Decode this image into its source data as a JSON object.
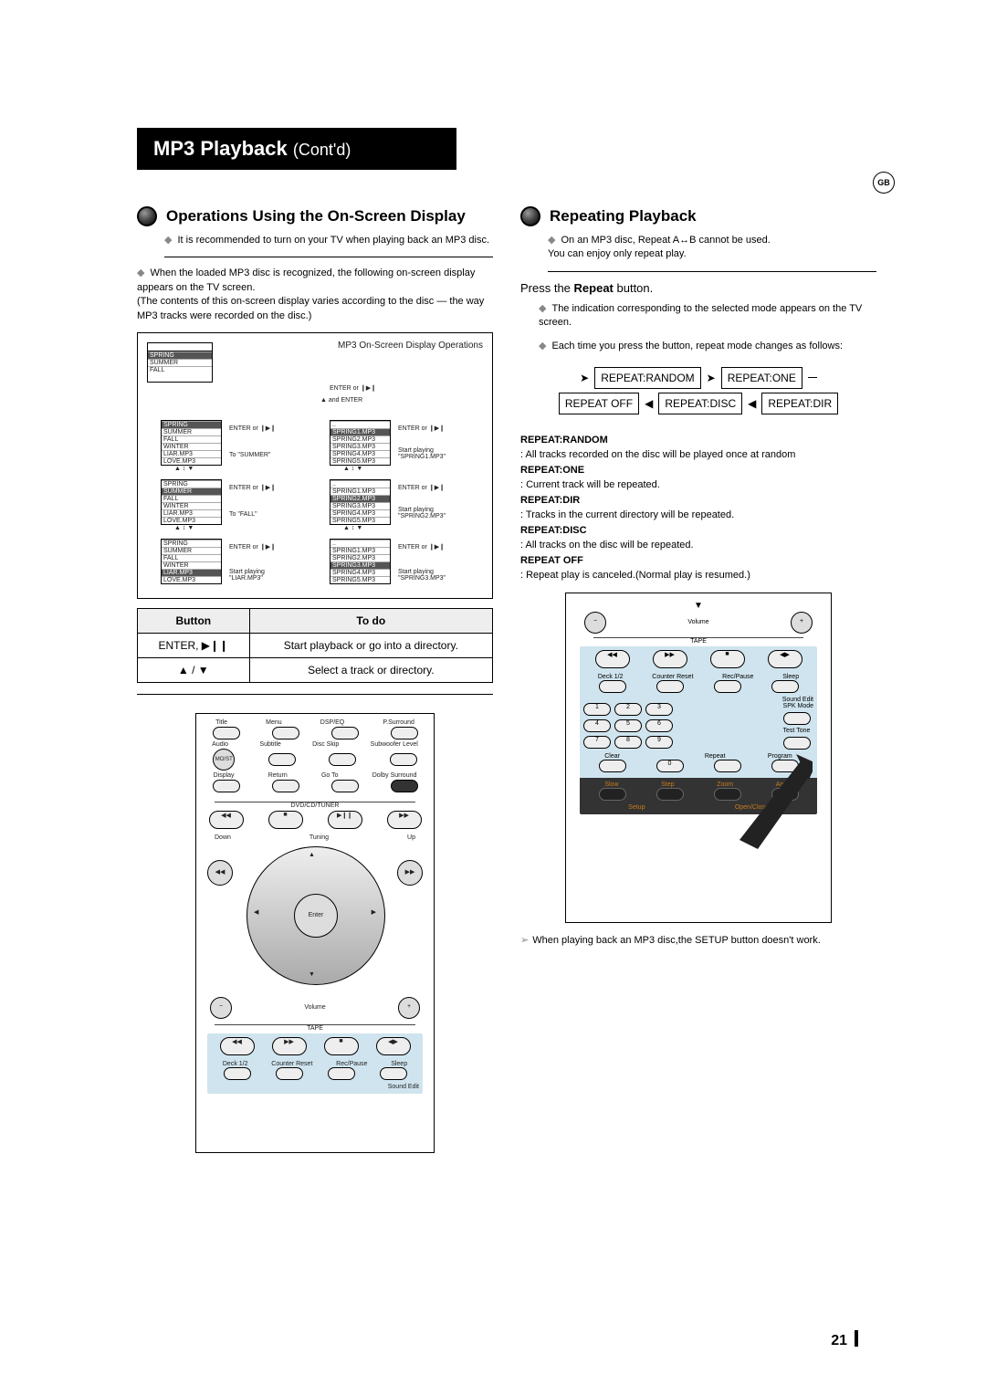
{
  "gb_label": "GB",
  "title_main": "MP3 Playback",
  "title_cont": "(Cont'd)",
  "left": {
    "heading": "Operations Using the On-Screen Display",
    "note1": "It is recommended to turn on your TV when playing back an MP3 disc.",
    "note2": "When the loaded MP3 disc is recognized, the following on-screen display appears on the TV screen.\n(The contents of this on-screen display varies according to the disc — the way MP3 tracks were recorded on the disc.)",
    "diagram_title": "MP3 On-Screen Display Operations",
    "folders": [
      "SPRING",
      "SUMMER",
      "FALL",
      "WINTER",
      "LIAR.MP3",
      "LOVE.MP3"
    ],
    "tracks_group": [
      "SPRING1.MP3",
      "SPRING2.MP3",
      "SPRING3.MP3",
      "SPRING4.MP3",
      "SPRING5.MP3"
    ],
    "enter_label": "ENTER or ❙▶❙",
    "nav_label_updown": "▲ ↕ ▼",
    "nav_label_and": "▲ and ENTER",
    "to_summer": "To \"SUMMER\"",
    "to_fall": "To \"FALL\"",
    "start1": "Start playing\n\"SPRING1.MP3\"",
    "start2": "Start playing\n\"SPRING2.MP3\"",
    "start3": "Start playing\n\"LIAR.MP3\"",
    "start4": "Start playing\n\"SPRING3.MP3\"",
    "table": {
      "head": [
        "Button",
        "To do"
      ],
      "rows": [
        [
          "ENTER, ▶❙❙",
          "Start playback or go into a directory."
        ],
        [
          "▲ / ▼",
          "Select a track or directory."
        ]
      ]
    },
    "remote_labels": [
      "Title",
      "Menu",
      "DSP/EQ",
      "P.Surround",
      "Audio",
      "Subtitle",
      "Disc Skip",
      "Subwoofer Level",
      "MO/ST",
      "Display",
      "Return",
      "Go To",
      "Dolby Surround",
      "DVD/CD/TUNER",
      "Down",
      "Tuning",
      "Up",
      "Enter",
      "Volume",
      "TAPE",
      "Deck 1/2",
      "Counter Reset",
      "Rec/Pause",
      "Sleep",
      "Sound Edit"
    ]
  },
  "right": {
    "heading": "Repeating Playback",
    "note1": "On an MP3 disc, Repeat A↔B cannot be used.\nYou can enjoy only repeat play.",
    "step": "Press the Repeat button.",
    "note2": "The indication corresponding to the selected mode appears on the TV screen.",
    "note3": "Each time you press the button, repeat mode changes as follows:",
    "flow": {
      "row1": [
        "REPEAT:RANDOM",
        "REPEAT:ONE"
      ],
      "row2": [
        "REPEAT OFF",
        "REPEAT:DISC",
        "REPEAT:DIR"
      ]
    },
    "defs": [
      {
        "t": "REPEAT:RANDOM",
        "d": ": All tracks recorded on the disc will be played once at random"
      },
      {
        "t": "REPEAT:ONE",
        "d": ": Current track will be repeated."
      },
      {
        "t": "REPEAT:DIR",
        "d": ": Tracks in the current directory will be repeated."
      },
      {
        "t": "REPEAT:DISC",
        "d": ": All tracks on the disc will be repeated."
      },
      {
        "t": "REPEAT OFF",
        "d": ": Repeat play is canceled.(Normal play is resumed.)"
      }
    ],
    "remote_labels": [
      "Volume",
      "TAPE",
      "Deck 1/2",
      "Counter Reset",
      "Rec/Pause",
      "Sleep",
      "Sound Edit",
      "SPK Mode",
      "Test Tone",
      "Clear",
      "Repeat",
      "Program",
      "Slow",
      "Step",
      "Zoom",
      "Angle",
      "Setup",
      "Open/Close"
    ],
    "numpad": [
      "1",
      "2",
      "3",
      "4",
      "5",
      "6",
      "7",
      "8",
      "9",
      "0"
    ],
    "footnote": "When playing back an MP3 disc,the SETUP button doesn't work."
  },
  "page_number": "21"
}
